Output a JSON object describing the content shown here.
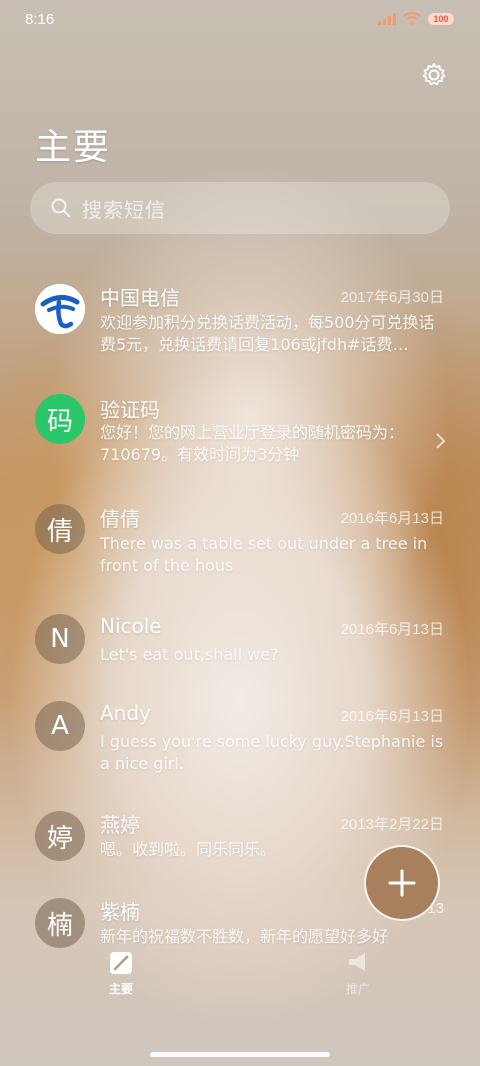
{
  "status": {
    "time": "8:16",
    "battery": "100"
  },
  "header": {
    "title": "主要"
  },
  "search": {
    "placeholder": "搜索短信"
  },
  "conversations": [
    {
      "avatar": "",
      "name": "中国电信",
      "date": "2017年6月30日",
      "preview": "欢迎参加积分兑换话费活动，每500分可兑换话费5元，兑换话费请回复106或jfdh#话费…"
    },
    {
      "avatar": "码",
      "name": "验证码",
      "date": "",
      "preview": "您好！您的网上营业厅登录的随机密码为：710679。有效时间为3分钟"
    },
    {
      "avatar": "倩",
      "name": "倩倩",
      "date": "2016年6月13日",
      "preview": "There was a table set out under a tree in front of the hous"
    },
    {
      "avatar": "N",
      "name": "Nicole",
      "date": "2016年6月13日",
      "preview": "Let's eat out,shall we?"
    },
    {
      "avatar": "A",
      "name": "Andy",
      "date": "2016年6月13日",
      "preview": "I guess you're some lucky guy.Stephanie is a nice girl."
    },
    {
      "avatar": "婷",
      "name": "燕婷",
      "date": "2013年2月22日",
      "preview": "嗯。收到啦。同乐同乐。"
    },
    {
      "avatar": "楠",
      "name": "紫楠",
      "date": "2013",
      "preview": "新年的祝福数不胜数，新年的愿望好多好"
    }
  ],
  "bottom_nav": {
    "primary": "主要",
    "promo": "推广"
  },
  "icons": {
    "settings": "gear-icon",
    "search": "search-icon",
    "compose": "plus-icon"
  }
}
